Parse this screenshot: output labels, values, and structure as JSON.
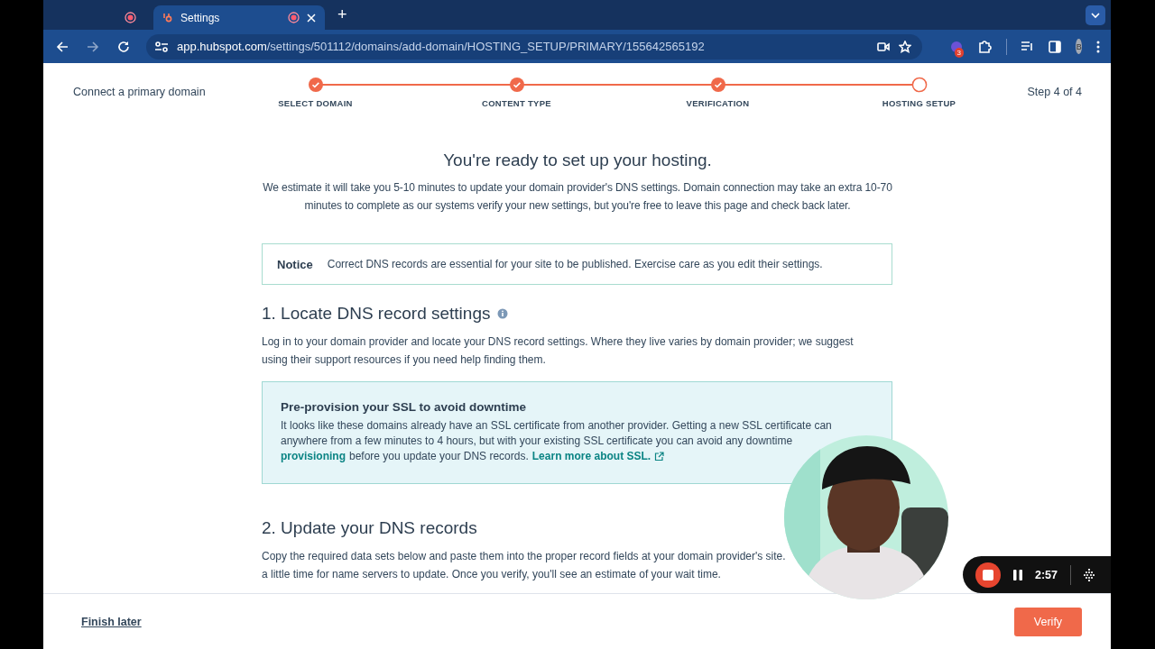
{
  "browser": {
    "tabs": [
      {
        "selected": false
      },
      {
        "title": "Settings",
        "selected": true
      }
    ],
    "new_tab": "+",
    "address_bar": {
      "domain": "app.hubspot.com",
      "path": "/settings/501112/domains/add-domain/HOSTING_SETUP/PRIMARY/155642565192"
    },
    "extension_badge": "3",
    "profile_initial": "B"
  },
  "wizard": {
    "title": "Connect a primary domain",
    "steps": [
      {
        "label": "SELECT DOMAIN",
        "completed": true
      },
      {
        "label": "CONTENT TYPE",
        "completed": true
      },
      {
        "label": "VERIFICATION",
        "completed": true
      },
      {
        "label": "HOSTING SETUP",
        "completed": false
      }
    ],
    "step_counter": "Step 4 of 4"
  },
  "content": {
    "heading": "You're ready to set up your hosting.",
    "intro": "We estimate it will take you 5-10 minutes to update your domain provider's DNS settings. Domain connection may take an extra 10-70 minutes to complete as our systems verify your new settings, but you're free to leave this page and check back later.",
    "notice": {
      "label": "Notice",
      "text": "Correct DNS records are essential for your site to be published. Exercise care as you edit their settings."
    },
    "sections": [
      {
        "title": "1. Locate DNS record settings",
        "info": true,
        "lines": [
          "Log in to your domain provider and locate your DNS record settings. Where they live varies by domain provider; we suggest",
          "using their support resources if you need help finding them."
        ],
        "callout": {
          "title": "Pre-provision your SSL to avoid downtime",
          "lines": [
            "It looks like these domains already have an SSL certificate from another provider. Getting a new SSL certificate can",
            "anywhere from a few minutes to 4 hours, but with your existing SSL certificate you can avoid any downtime"
          ],
          "link": "provisioning",
          "text": "before you update your DNS records.",
          "learn_more": "Learn more about SSL."
        }
      },
      {
        "title": "2. Update your DNS records",
        "info": false,
        "lines": [
          "Copy the required data sets below and paste them into the proper record fields at your domain provider's site.",
          "a little time for name servers to update. Once you verify, you'll see an estimate of your wait time."
        ]
      }
    ]
  },
  "footer": {
    "link": "Finish later",
    "button": "Verify"
  },
  "recorder": {
    "time": "2:57"
  }
}
